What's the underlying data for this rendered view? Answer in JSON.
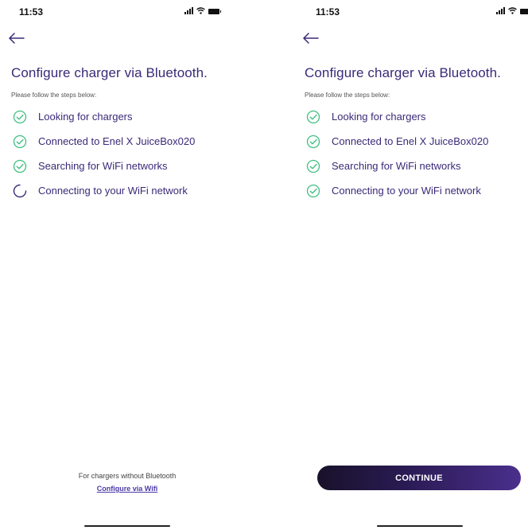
{
  "screens": [
    {
      "status_time": "11:53",
      "title": "Configure charger via Bluetooth.",
      "subtitle": "Please follow the steps below:",
      "steps": [
        {
          "label": "Looking for chargers",
          "state": "done"
        },
        {
          "label": "Connected to Enel X JuiceBox020",
          "state": "done"
        },
        {
          "label": "Searching for WiFi networks",
          "state": "done"
        },
        {
          "label": "Connecting to your WiFi network",
          "state": "in-progress"
        }
      ],
      "footer_text": "For chargers without Bluetooth",
      "footer_link": "Configure via Wifi"
    },
    {
      "status_time": "11:53",
      "title": "Configure charger via Bluetooth.",
      "subtitle": "Please follow the steps below:",
      "steps": [
        {
          "label": "Looking for chargers",
          "state": "done"
        },
        {
          "label": "Connected to Enel X JuiceBox020",
          "state": "done"
        },
        {
          "label": "Searching for WiFi networks",
          "state": "done"
        },
        {
          "label": "Connecting to your WiFi network",
          "state": "done"
        }
      ],
      "continue_label": "CONTINUE"
    }
  ],
  "colors": {
    "accent_purple": "#3b2a78",
    "check_green": "#3fbf7f",
    "link_purple": "#4a3aa8",
    "button_dark": "#18122a",
    "button_light": "#4a2f8c"
  },
  "icons": {
    "back": "arrow-left-icon",
    "done": "check-circle-icon",
    "in_progress": "spinner-icon",
    "signal": "signal-icon",
    "wifi": "wifi-icon",
    "battery": "battery-icon"
  }
}
